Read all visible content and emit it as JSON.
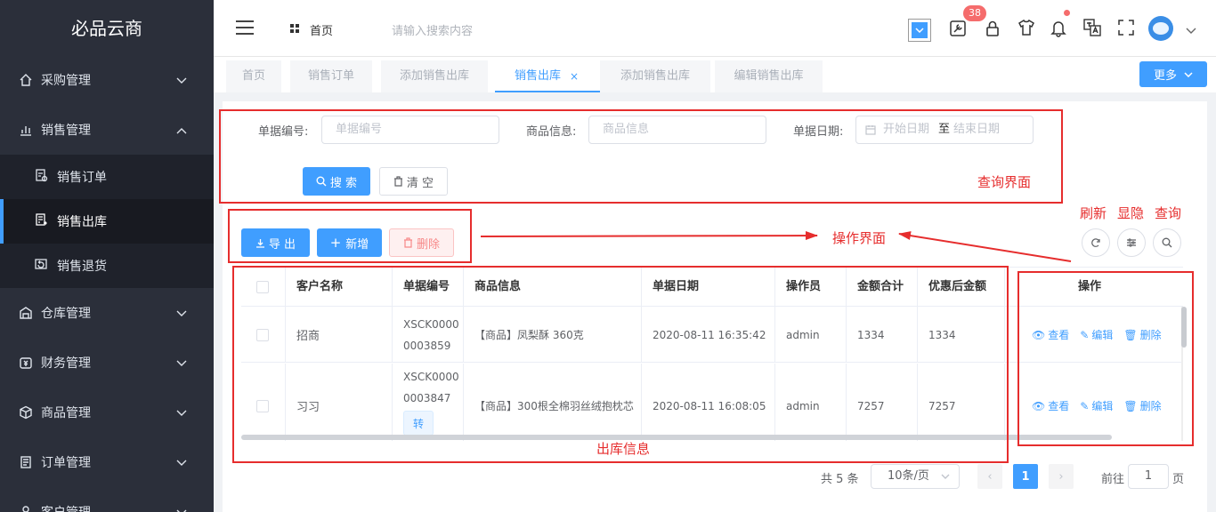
{
  "sidebar": {
    "brand": "必品云商",
    "menus": [
      {
        "label": "采购管理",
        "icon": "home-cart-icon",
        "expanded": false
      },
      {
        "label": "销售管理",
        "icon": "bar-chart-icon",
        "expanded": true
      },
      {
        "label": "仓库管理",
        "icon": "warehouse-icon",
        "expanded": false
      },
      {
        "label": "财务管理",
        "icon": "finance-icon",
        "expanded": false
      },
      {
        "label": "商品管理",
        "icon": "cube-icon",
        "expanded": false
      },
      {
        "label": "订单管理",
        "icon": "document-icon",
        "expanded": false
      },
      {
        "label": "客户管理",
        "icon": "user-icon",
        "expanded": false
      }
    ],
    "sales_sub": [
      {
        "label": "销售订单",
        "active": false
      },
      {
        "label": "销售出库",
        "active": true
      },
      {
        "label": "销售退货",
        "active": false
      }
    ]
  },
  "header": {
    "home_label": "首页",
    "search_placeholder": "请输入搜索内容",
    "notification_count": "38"
  },
  "tabs": [
    {
      "label": "首页",
      "active": false
    },
    {
      "label": "销售订单",
      "active": false
    },
    {
      "label": "添加销售出库",
      "active": false
    },
    {
      "label": "销售出库",
      "active": true
    },
    {
      "label": "添加销售出库",
      "active": false
    },
    {
      "label": "编辑销售出库",
      "active": false
    }
  ],
  "more_label": "更多",
  "query": {
    "doc_no_label": "单据编号:",
    "doc_no_placeholder": "单据编号",
    "goods_label": "商品信息:",
    "goods_placeholder": "商品信息",
    "date_label": "单据日期:",
    "start_placeholder": "开始日期",
    "to_label": "至",
    "end_placeholder": "结束日期",
    "search_btn": "搜 索",
    "clear_btn": "清 空"
  },
  "actions": {
    "export": "导 出",
    "add": "新增",
    "delete": "删除"
  },
  "tool_labels": {
    "refresh": "刷新",
    "toggle": "显隐",
    "query": "查询"
  },
  "annotations": {
    "query_area": "查询界面",
    "action_area": "操作界面",
    "outbound_info": "出库信息"
  },
  "table": {
    "headers": [
      "客户名称",
      "单据编号",
      "商品信息",
      "单据日期",
      "操作员",
      "金额合计",
      "优惠后金额",
      "操作"
    ],
    "rows": [
      {
        "customer": "招商",
        "doc_no_1": "XSCK0000",
        "doc_no_2": "0003859",
        "goods": "【商品】凤梨酥 360克",
        "date": "2020-08-11 16:35:42",
        "operator": "admin",
        "total": "1334",
        "discount": "1334",
        "tag": ""
      },
      {
        "customer": "习习",
        "doc_no_1": "XSCK0000",
        "doc_no_2": "0003847",
        "goods": "【商品】300根全棉羽丝绒抱枕芯",
        "date": "2020-08-11 16:08:05",
        "operator": "admin",
        "total": "7257",
        "discount": "7257",
        "tag": "转"
      }
    ],
    "op_view": "查看",
    "op_edit": "编辑",
    "op_delete": "删除"
  },
  "pagination": {
    "total_text": "共 5 条",
    "page_size": "10条/页",
    "current_page": "1",
    "goto_label": "前往",
    "goto_value": "1",
    "page_suffix": "页"
  },
  "colors": {
    "primary": "#409eff",
    "annotation": "#e62d2d",
    "sidebar": "#2b2f3a"
  }
}
